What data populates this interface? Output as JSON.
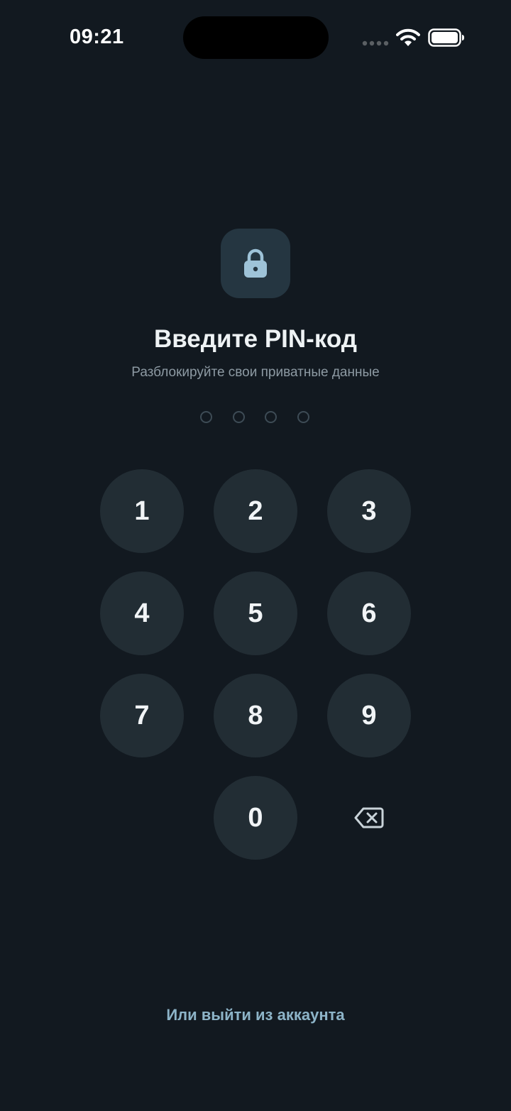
{
  "status_bar": {
    "time": "09:21"
  },
  "lock": {
    "icon": "lock-icon"
  },
  "pin": {
    "title": "Введите PIN-код",
    "subtitle": "Разблокируйте свои приватные данные",
    "digits_entered": 0,
    "length": 4
  },
  "keypad": {
    "keys": [
      "1",
      "2",
      "3",
      "4",
      "5",
      "6",
      "7",
      "8",
      "9",
      "0"
    ],
    "backspace_icon": "backspace-icon"
  },
  "footer": {
    "logout_label": "Или выйти из аккаунта"
  },
  "colors": {
    "background": "#121920",
    "key_background": "#222d34",
    "accent": "#8db4c8",
    "lock_badge": "#253641"
  }
}
